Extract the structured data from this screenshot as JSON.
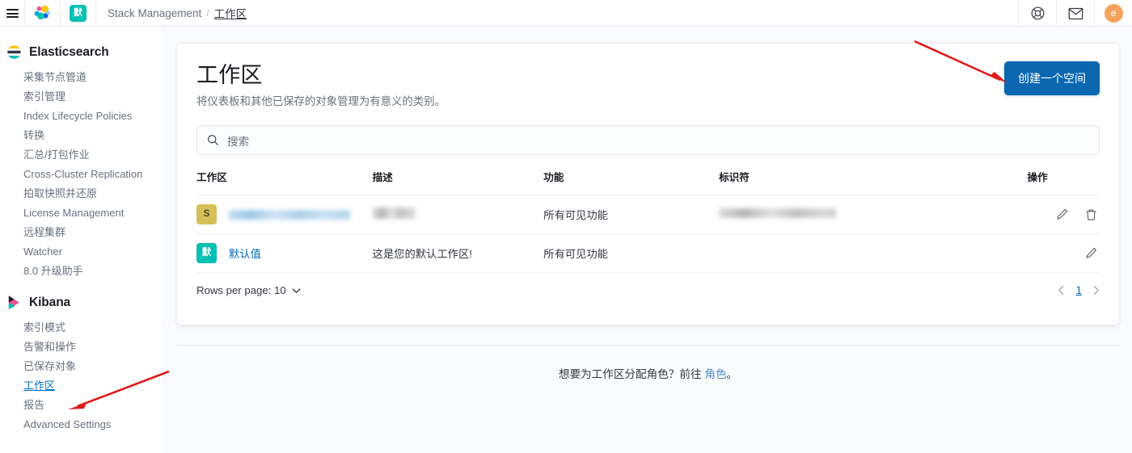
{
  "header": {
    "menu_icon": "hamburger-icon",
    "elastic_logo": "elastic-logo-icon",
    "space_chip": "默",
    "breadcrumbs": [
      {
        "label": "Stack Management",
        "current": false
      },
      {
        "label": "工作区",
        "current": true
      }
    ],
    "breadcrumb_separator": "/",
    "help_icon": "help-lifebuoy-icon",
    "mail_icon": "mail-envelope-icon",
    "avatar_initial": "e",
    "avatar_color": "#f5a35c"
  },
  "sidebar": {
    "groups": [
      {
        "title": "Elasticsearch",
        "logo": "elasticsearch-logo-icon",
        "items": [
          {
            "label": "采集节点管道",
            "active": false
          },
          {
            "label": "索引管理",
            "active": false
          },
          {
            "label": "Index Lifecycle Policies",
            "active": false
          },
          {
            "label": "转换",
            "active": false
          },
          {
            "label": "汇总/打包作业",
            "active": false
          },
          {
            "label": "Cross-Cluster Replication",
            "active": false
          },
          {
            "label": "拍取快照并还原",
            "active": false
          },
          {
            "label": "License Management",
            "active": false
          },
          {
            "label": "远程集群",
            "active": false
          },
          {
            "label": "Watcher",
            "active": false
          },
          {
            "label": "8.0 升级助手",
            "active": false
          }
        ]
      },
      {
        "title": "Kibana",
        "logo": "kibana-logo-icon",
        "items": [
          {
            "label": "索引模式",
            "active": false
          },
          {
            "label": "告警和操作",
            "active": false
          },
          {
            "label": "已保存对象",
            "active": false
          },
          {
            "label": "工作区",
            "active": true
          },
          {
            "label": "报告",
            "active": false
          },
          {
            "label": "Advanced Settings",
            "active": false
          }
        ]
      }
    ]
  },
  "main": {
    "title": "工作区",
    "subtitle": "将仪表板和其他已保存的对象管理为有意义的类别。",
    "create_button": "创建一个空间",
    "search": {
      "placeholder": "搜索",
      "value": "",
      "icon": "search-icon"
    },
    "table": {
      "columns": [
        "工作区",
        "描述",
        "功能",
        "标识符",
        "操作"
      ],
      "rows": [
        {
          "chip": "S",
          "chip_color": "#d6bf57",
          "name": "[已隐去]",
          "name_redacted": true,
          "description": "[已隐去]",
          "description_redacted": true,
          "features": "所有可见功能",
          "identifier": "[已隐去]",
          "identifier_redacted": true,
          "actions": [
            "edit-pencil-icon",
            "delete-trash-icon"
          ]
        },
        {
          "chip": "默",
          "chip_color": "#00bfb3",
          "name": "默认值",
          "name_redacted": false,
          "description": "这是您的默认工作区!",
          "description_redacted": false,
          "features": "所有可见功能",
          "identifier": "",
          "identifier_redacted": false,
          "actions": [
            "edit-pencil-icon"
          ]
        }
      ]
    },
    "footer": {
      "rows_per_page_label": "Rows per page: 10",
      "chevron_icon": "chevron-down-icon",
      "prev_icon": "chevron-left-icon",
      "next_icon": "chevron-right-icon",
      "page_number": "1"
    },
    "bottom_note": {
      "prefix": "想要为工作区分配角色？前往 ",
      "link": "角色",
      "suffix": "。"
    }
  },
  "annotations": {
    "arrow_color": "#e01b1b",
    "arrow_to_create_button": "arrow-annotation-create-button",
    "arrow_to_sidebar_spaces": "arrow-annotation-sidebar-spaces"
  }
}
